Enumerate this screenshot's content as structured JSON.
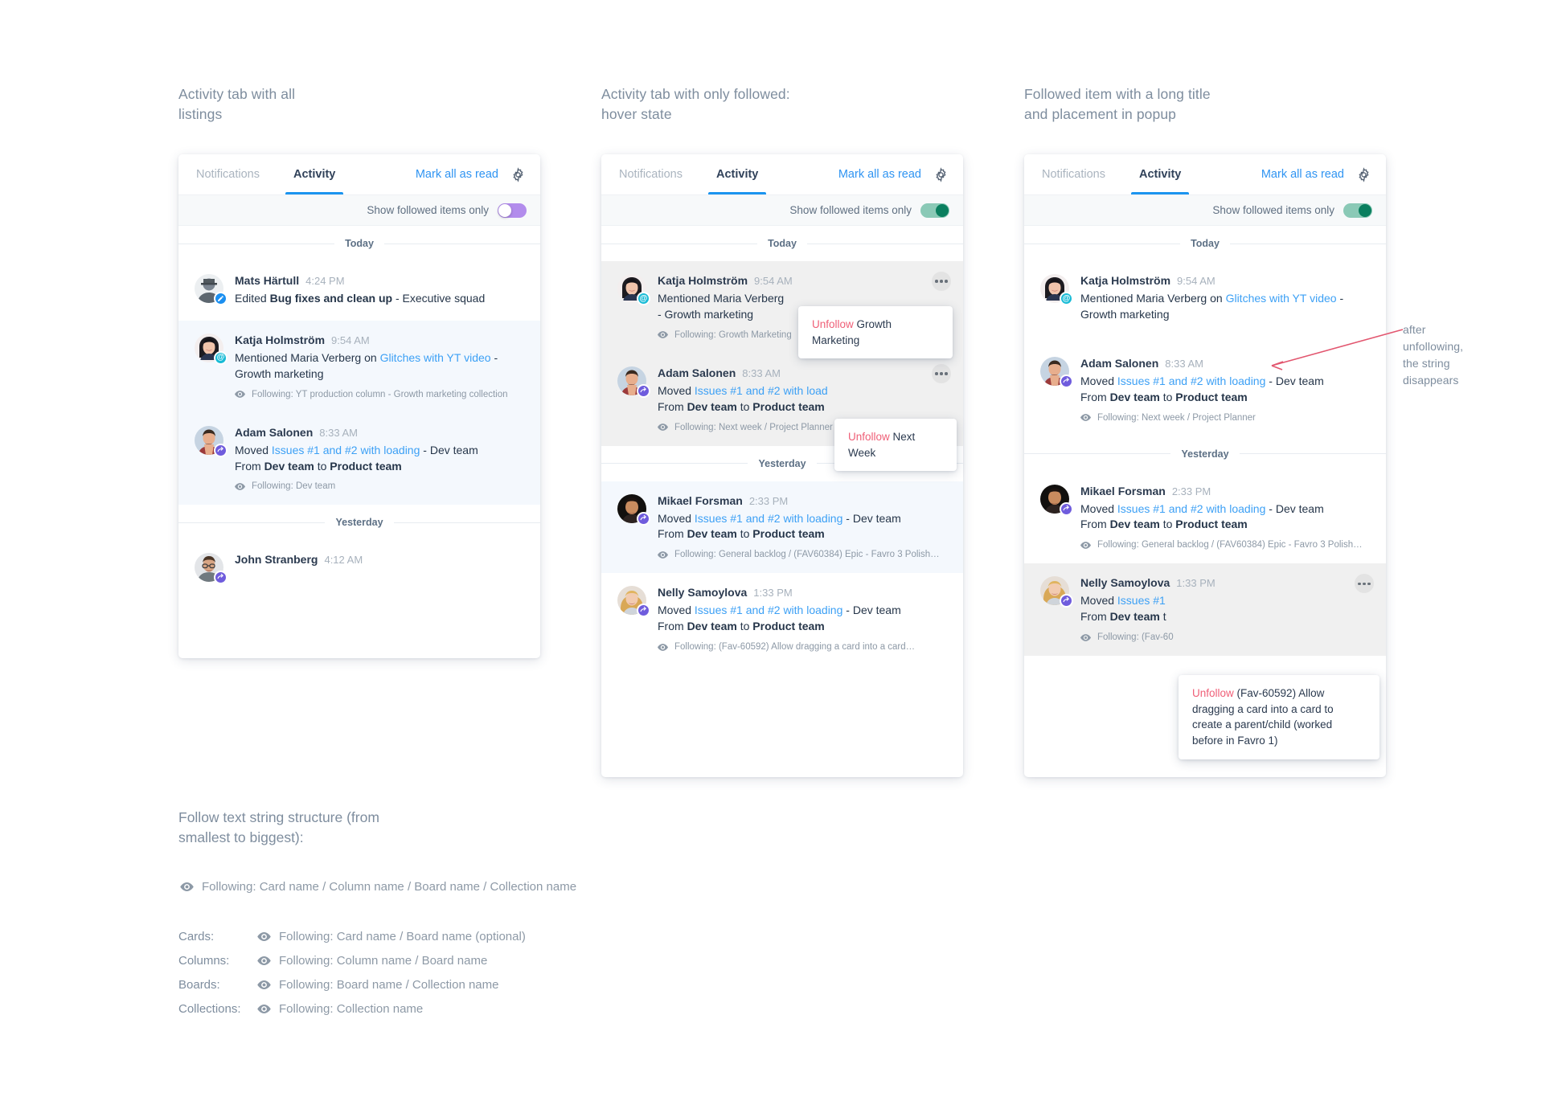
{
  "captions": {
    "panel1": "Activity tab with all\nlistings",
    "panel2": "Activity tab with only followed:\nhover state",
    "panel3": "Followed item with a long title\nand placement in popup",
    "arrow_note": "after\nunfollowing,\nthe string\ndisappears"
  },
  "header": {
    "tab_notifications": "Notifications",
    "tab_activity": "Activity",
    "mark_all_as_read": "Mark all as read",
    "gear_icon": "gear-icon"
  },
  "filter": {
    "label": "Show followed items only",
    "state_off": "off",
    "state_on": "on"
  },
  "day_labels": {
    "today": "Today",
    "yesterday": "Yesterday"
  },
  "colors": {
    "link": "#3ca0f5",
    "accent_blue": "#1b94ef",
    "unfollow_red": "#ef5f77",
    "toggle_off": "#b28cec",
    "toggle_on": "#0a7f5f",
    "row_read_bg": "#f4f8fd",
    "row_hover_bg": "#f0f0f0",
    "caption_text": "#7e8d9e",
    "arrow": "#e2566f"
  },
  "panel1": {
    "items": [
      {
        "name": "Mats Härtull",
        "time": "4:24 PM",
        "badge": "edit",
        "msg_pre": "Edited ",
        "msg_bold": "Bug fixes and clean up",
        "msg_post": " - Executive squad",
        "following": null,
        "read": false
      },
      {
        "name": "Katja Holmström",
        "time": "9:54 AM",
        "badge": "mention",
        "msg_pre": "Mentioned Maria Verberg on ",
        "msg_link": "Glitches with YT video",
        "msg_post": " - Growth marketing",
        "following": "Following: YT production column - Growth marketing collection",
        "read": true
      },
      {
        "name": "Adam Salonen",
        "time": "8:33 AM",
        "badge": "move",
        "msg_pre": "Moved ",
        "msg_link": "Issues #1 and #2 with loading",
        "msg_post": " -  Dev team",
        "msg_line2_pre": "From ",
        "msg_line2_b1": "Dev team",
        "msg_line2_mid": " to ",
        "msg_line2_b2": "Product team",
        "following": "Following: Dev team",
        "read": true
      },
      {
        "name": "John Stranberg",
        "time": "4:12 AM",
        "badge": "move",
        "msg_pre": "",
        "following": null,
        "read": false
      }
    ]
  },
  "panel2": {
    "items": [
      {
        "name": "Katja Holmström",
        "time": "9:54 AM",
        "badge": "mention",
        "msg_pre": "Mentioned Maria Verberg",
        "msg_post": "- Growth marketing",
        "following": "Following: Growth Marketing",
        "hover": true,
        "popup": {
          "unfollow": "Unfollow",
          "target": " Growth Marketing"
        }
      },
      {
        "name": "Adam Salonen",
        "time": "8:33 AM",
        "badge": "move",
        "msg_pre": "Moved ",
        "msg_link": "Issues #1 and #2 with load",
        "msg_line2_pre": "From ",
        "msg_line2_b1": "Dev team",
        "msg_line2_mid": " to ",
        "msg_line2_b2": "Product team",
        "following": "Following: Next week / Project Planner",
        "hover": true,
        "popup": {
          "unfollow": "Unfollow",
          "target": " Next Week"
        }
      },
      {
        "name": "Mikael Forsman",
        "time": "2:33 PM",
        "badge": "move",
        "msg_pre": "Moved ",
        "msg_link": "Issues #1 and #2 with loading",
        "msg_post": " -  Dev team",
        "msg_line2_pre": "From ",
        "msg_line2_b1": "Dev team",
        "msg_line2_mid": " to ",
        "msg_line2_b2": "Product team",
        "following": "Following: General backlog / (FAV60384) Epic - Favro 3 Polish…",
        "read": true
      },
      {
        "name": "Nelly Samoylova",
        "time": "1:33 PM",
        "badge": "move",
        "msg_pre": "Moved ",
        "msg_link": "Issues #1 and #2 with loading",
        "msg_post": " -  Dev team",
        "msg_line2_pre": "From ",
        "msg_line2_b1": "Dev team",
        "msg_line2_mid": " to ",
        "msg_line2_b2": "Product team",
        "following": "Following: (Fav-60592) Allow dragging a card into a card…",
        "read": false
      }
    ]
  },
  "panel3": {
    "items": [
      {
        "name": "Katja Holmström",
        "time": "9:54 AM",
        "badge": "mention",
        "msg_pre": "Mentioned Maria Verberg on ",
        "msg_link": "Glitches with YT video",
        "msg_post": " - Growth marketing",
        "following": null,
        "read": false
      },
      {
        "name": "Adam Salonen",
        "time": "8:33 AM",
        "badge": "move",
        "msg_pre": "Moved ",
        "msg_link": "Issues #1 and #2 with loading",
        "msg_post": " -  Dev team",
        "msg_line2_pre": "From ",
        "msg_line2_b1": "Dev team",
        "msg_line2_mid": " to ",
        "msg_line2_b2": "Product team",
        "following": "Following: Next week / Project Planner",
        "read": false
      },
      {
        "name": "Mikael Forsman",
        "time": "2:33 PM",
        "badge": "move",
        "msg_pre": "Moved ",
        "msg_link": "Issues #1 and #2 with loading",
        "msg_post": " -  Dev team",
        "msg_line2_pre": "From ",
        "msg_line2_b1": "Dev team",
        "msg_line2_mid": " to ",
        "msg_line2_b2": "Product team",
        "following": "Following: General backlog / (FAV60384) Epic - Favro 3 Polish…",
        "read": false
      },
      {
        "name": "Nelly Samoylova",
        "time": "1:33 PM",
        "badge": "move",
        "msg_pre": "Moved ",
        "msg_link": "Issues #1",
        "msg_line2_pre": "From ",
        "msg_line2_b1": "Dev team",
        "msg_line2_mid": " t",
        "following": "Following: (Fav-60",
        "hover": true,
        "popup": {
          "unfollow": "Unfollow",
          "target": " (Fav-60592) Allow dragging a card into a card to create a parent/child (worked before in Favro 1)"
        }
      }
    ]
  },
  "legend": {
    "title": "Follow text string structure (from\nsmallest to biggest):",
    "main": "Following: Card name / Column name / Board name / Collection name",
    "rows": [
      {
        "key": "Cards:",
        "value": "Following: Card name / Board name (optional)"
      },
      {
        "key": "Columns:",
        "value": "Following: Column name / Board name"
      },
      {
        "key": "Boards:",
        "value": "Following: Board name / Collection name"
      },
      {
        "key": "Collections:",
        "value": "Following: Collection name"
      }
    ]
  }
}
